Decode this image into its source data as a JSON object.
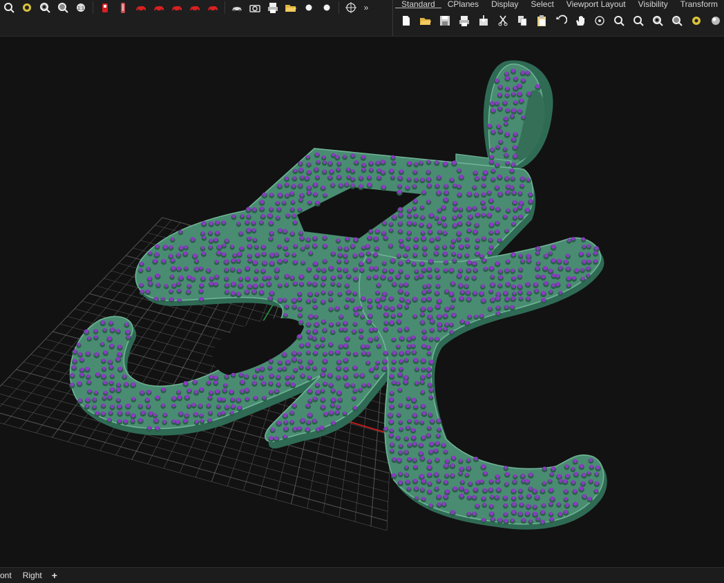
{
  "toolbar": {
    "left_buttons": [
      {
        "icon": "zoom-extents-icon"
      },
      {
        "icon": "render-shade-icon"
      },
      {
        "icon": "zoom-window-icon"
      },
      {
        "icon": "zoom-selected-icon"
      },
      {
        "icon": "zoom-all-icon"
      },
      {
        "icon": "red-object-icon"
      },
      {
        "icon": "red-figure-icon"
      },
      {
        "icon": "red-car-icon"
      },
      {
        "icon": "red-car-icon"
      },
      {
        "icon": "red-car-icon"
      },
      {
        "icon": "red-car-icon"
      },
      {
        "icon": "red-car-icon"
      },
      {
        "icon": "camera-car-icon"
      },
      {
        "icon": "camera-icon"
      },
      {
        "icon": "print-icon"
      },
      {
        "icon": "open-folder-icon"
      },
      {
        "icon": "white-sphere-icon"
      },
      {
        "icon": "white-sphere-icon"
      },
      {
        "icon": "crosshair-icon"
      }
    ],
    "more": "»",
    "tabs": [
      "Standard",
      "CPlanes",
      "Display",
      "Select",
      "Viewport Layout",
      "Visibility",
      "Transform"
    ],
    "active_tab": "Standard",
    "right_buttons": [
      {
        "icon": "new-file-icon"
      },
      {
        "icon": "open-folder-icon"
      },
      {
        "icon": "save-icon"
      },
      {
        "icon": "print-icon"
      },
      {
        "icon": "import-icon"
      },
      {
        "icon": "cut-icon"
      },
      {
        "icon": "copy-icon"
      },
      {
        "icon": "paste-icon"
      },
      {
        "icon": "undo-icon"
      },
      {
        "icon": "pan-hand-icon"
      },
      {
        "icon": "rotate-view-icon"
      },
      {
        "icon": "zoom-icon"
      },
      {
        "icon": "zoom-extents-icon"
      },
      {
        "icon": "zoom-window-icon"
      },
      {
        "icon": "zoom-selected-icon"
      },
      {
        "icon": "render-icon"
      },
      {
        "icon": "sphere-icon"
      },
      {
        "icon": "viewport-layout-icon"
      }
    ]
  },
  "viewport": {
    "model_color": "#4a8c72",
    "stone_color": "#8a3cc2",
    "grid_color": "#6a6a6a",
    "x_axis_color": "#c81e1e",
    "y_axis_color": "#1e9a3c"
  },
  "statusbar": {
    "tabs": [
      "ont",
      "Right"
    ],
    "add_label": "+"
  }
}
